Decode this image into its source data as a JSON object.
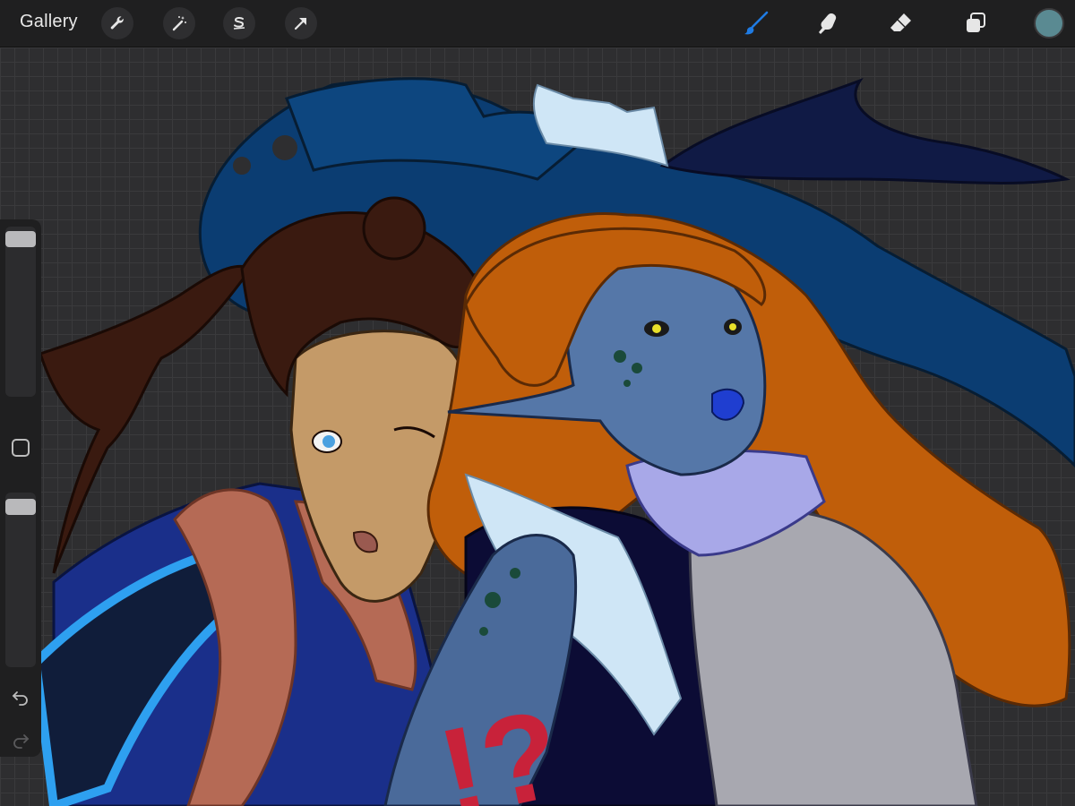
{
  "toolbar": {
    "gallery_label": "Gallery",
    "left_tools": [
      {
        "name": "actions",
        "icon": "wrench-icon"
      },
      {
        "name": "adjustments",
        "icon": "magic-wand-icon"
      },
      {
        "name": "selection",
        "icon": "selection-s-icon"
      },
      {
        "name": "transform",
        "icon": "arrow-cursor-icon"
      }
    ],
    "right_tools": [
      {
        "name": "brush",
        "icon": "brush-icon",
        "active": true
      },
      {
        "name": "smudge",
        "icon": "smudge-finger-icon"
      },
      {
        "name": "eraser",
        "icon": "eraser-icon"
      },
      {
        "name": "layers",
        "icon": "layers-icon"
      }
    ],
    "current_color": "#5a8a92",
    "active_tool_color": "#1f7be3"
  },
  "sidebar": {
    "brush_size_level": 0.97,
    "opacity_level": 0.96
  },
  "artwork": {
    "overlay_text": "!?",
    "overlay_color": "#c8223a"
  }
}
